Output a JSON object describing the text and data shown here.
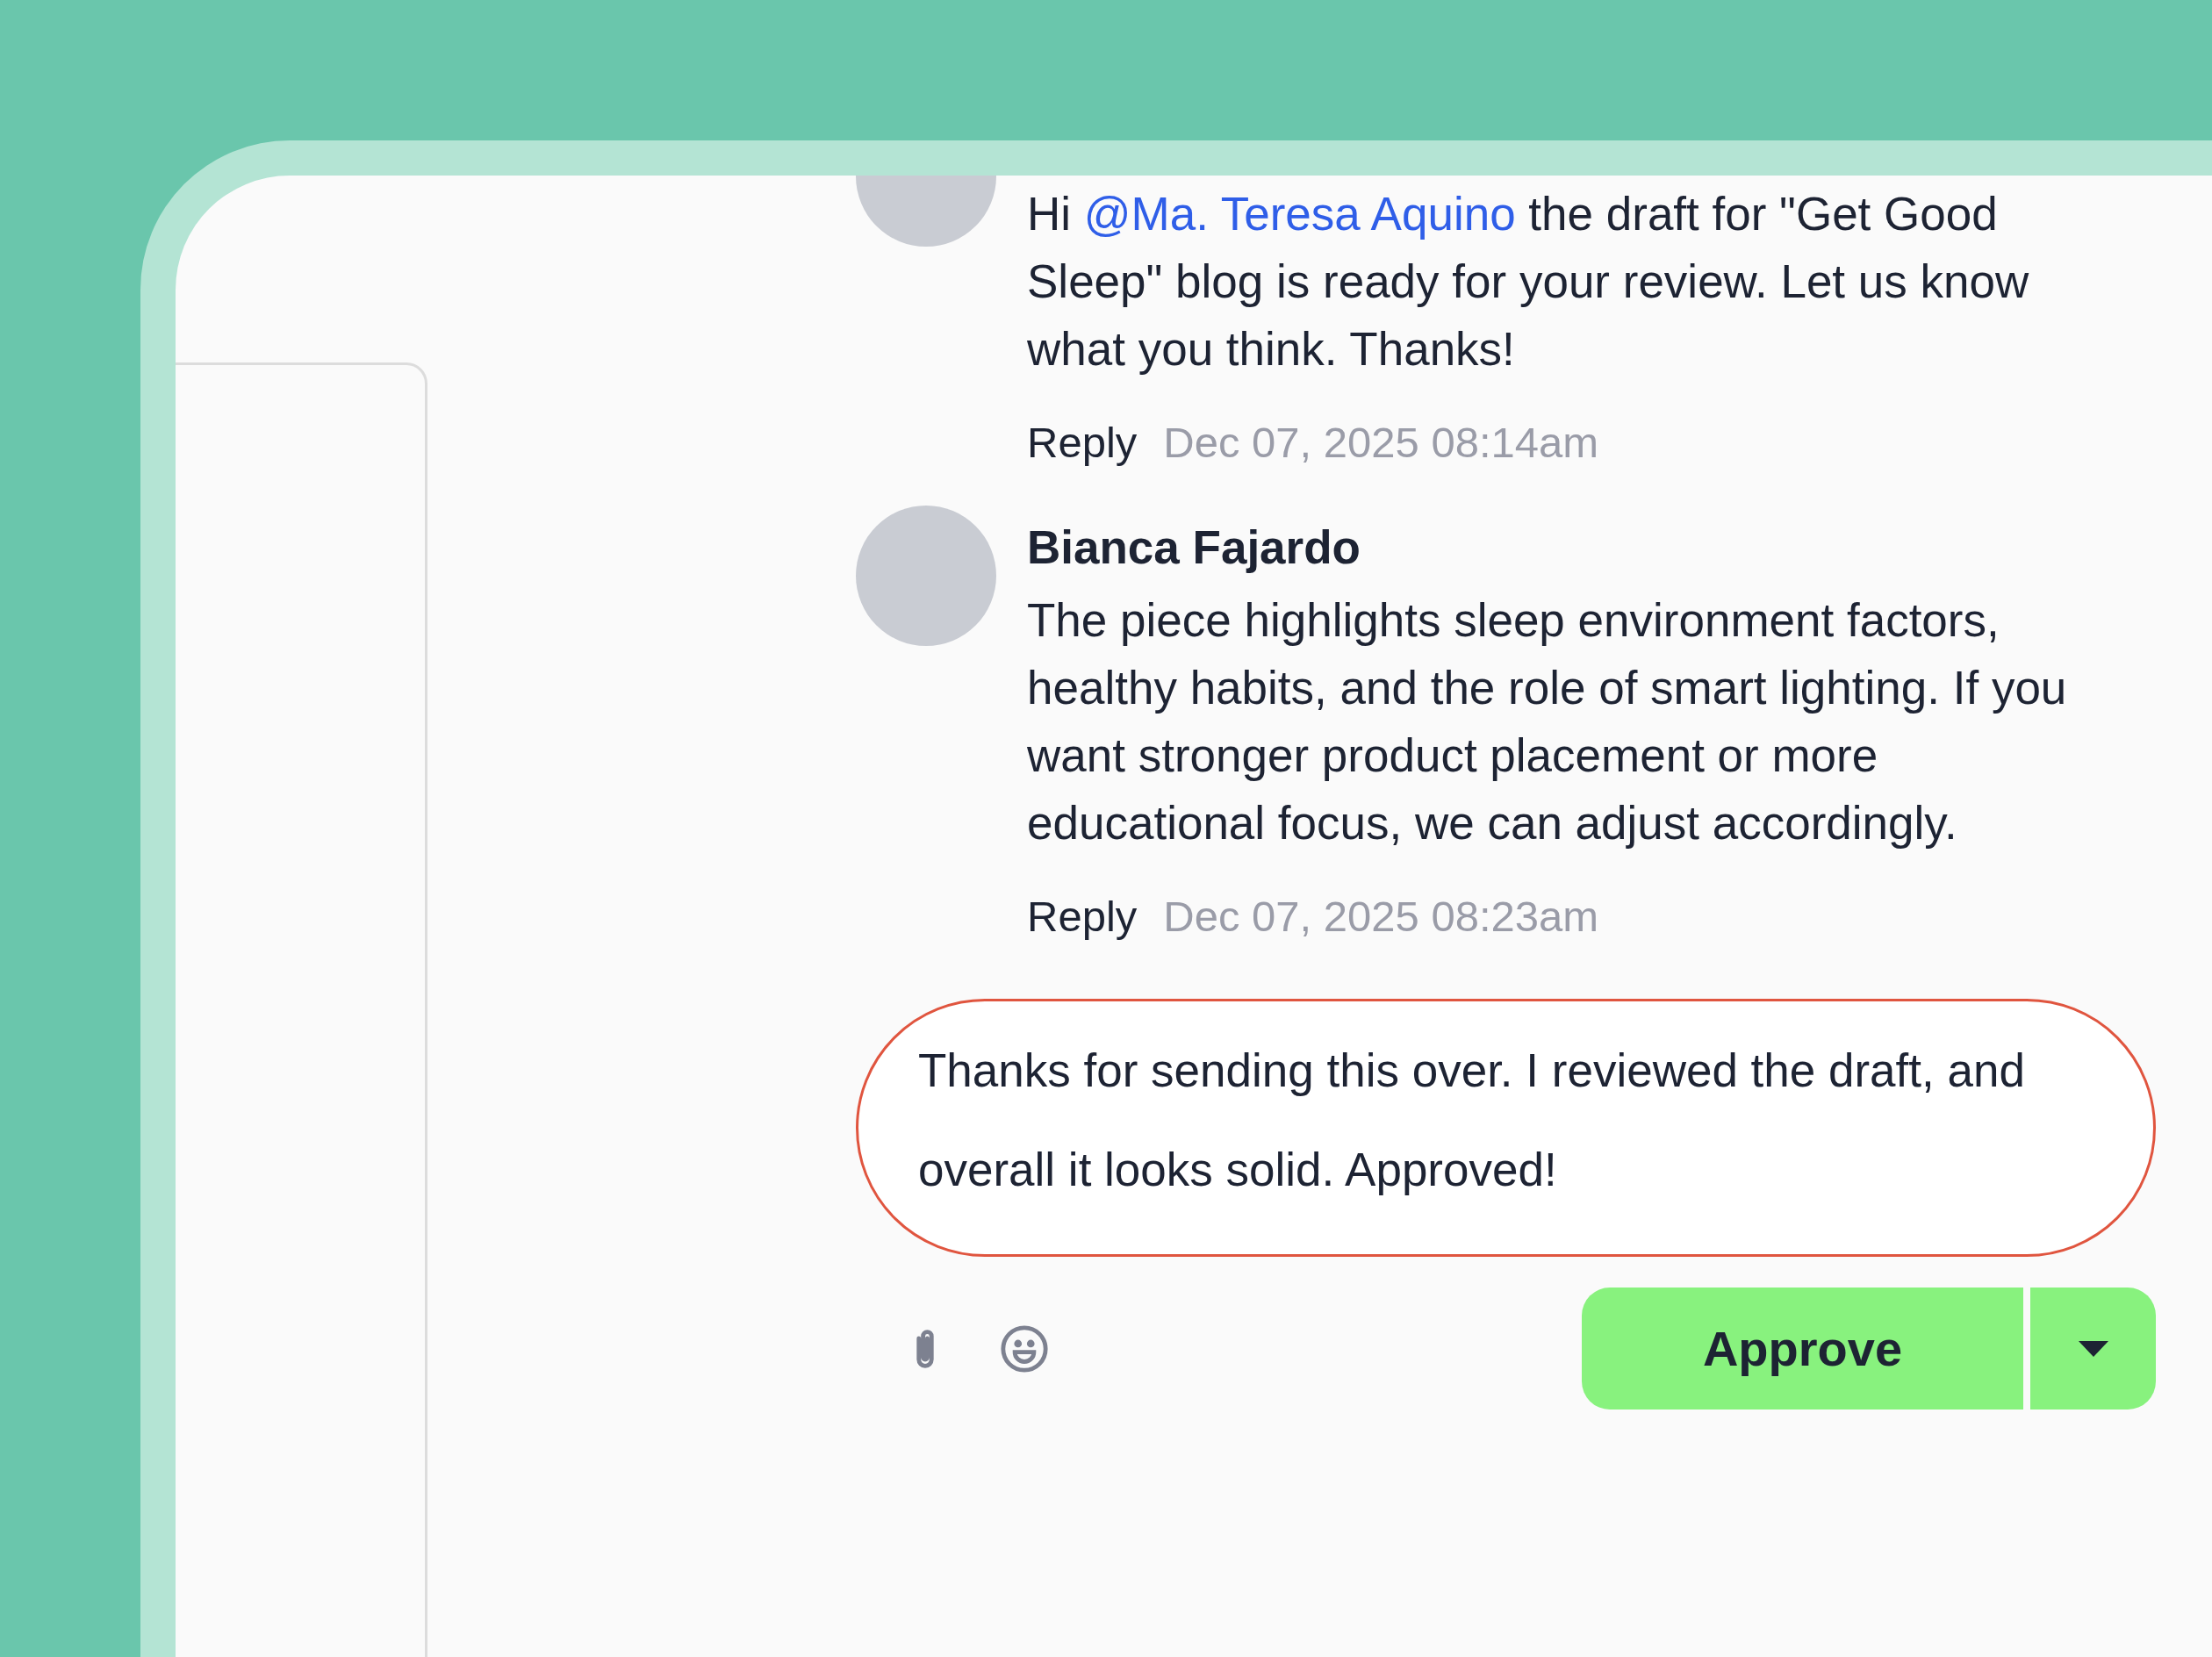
{
  "comments": [
    {
      "segments": [
        {
          "kind": "text",
          "text": "Hi "
        },
        {
          "kind": "mention",
          "text": "@Ma. Teresa Aquino"
        },
        {
          "kind": "text",
          "text": " the draft for \"Get Good Sleep\" blog is ready for your review. Let us know what you think. Thanks!"
        }
      ],
      "reply": "Reply",
      "time": "Dec 07, 2025 08:14am"
    },
    {
      "author": "Bianca Fajardo",
      "segments": [
        {
          "kind": "text",
          "text": "The piece highlights sleep environment factors, healthy habits, and the role of smart lighting. If you want stronger product placement or more educational focus, we can adjust accordingly."
        }
      ],
      "reply": "Reply",
      "time": "Dec 07, 2025 08:23am"
    }
  ],
  "composer": {
    "value": "Thanks for sending this over. I reviewed the draft, and overall it looks solid. Approved!",
    "action": "Approve"
  }
}
